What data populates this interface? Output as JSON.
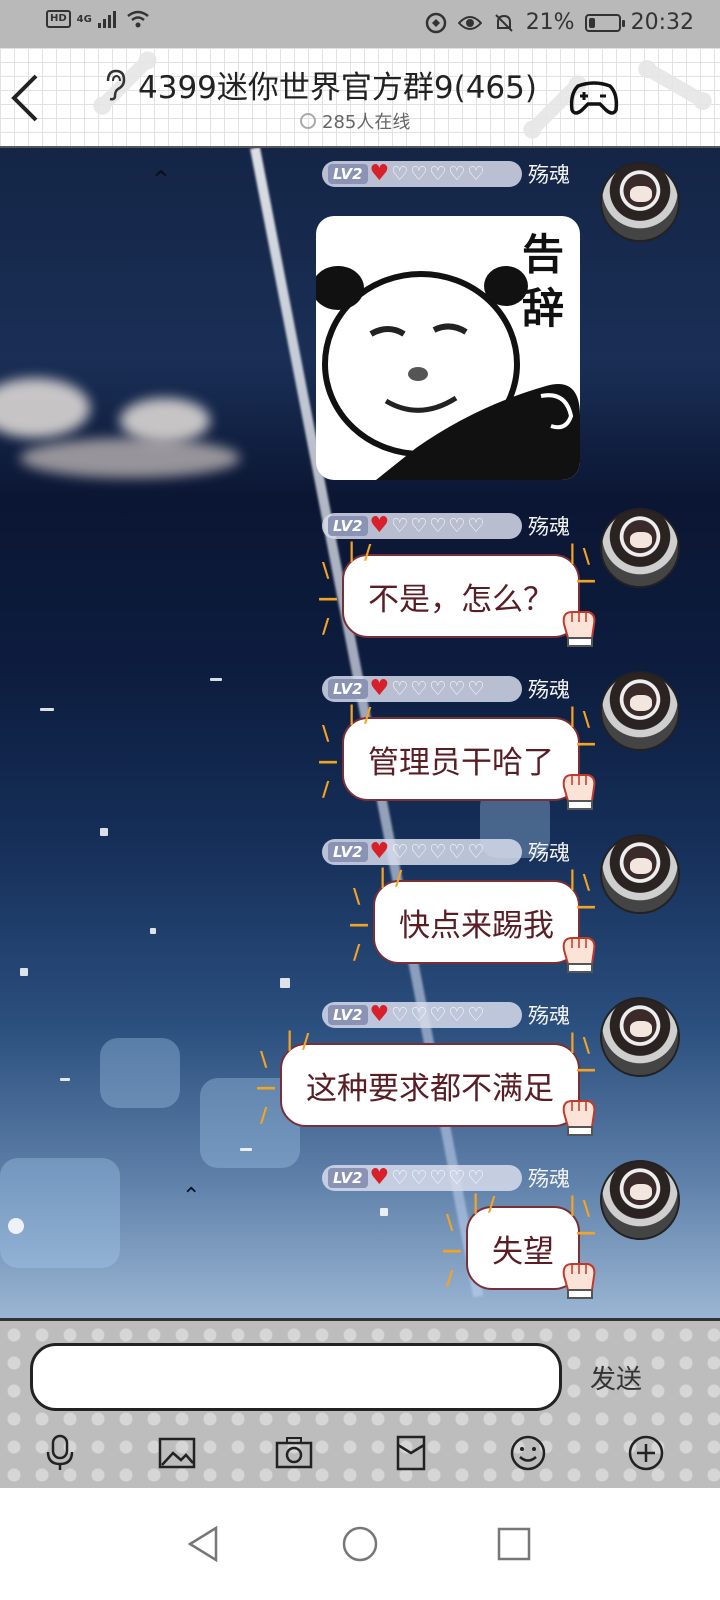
{
  "status_bar": {
    "hd": "HD",
    "network": "4G",
    "battery_percent": "21%",
    "battery_level": 0.21,
    "time": "20:32"
  },
  "header": {
    "title": "4399迷你世界官方群9(465)",
    "online_text": "285人在线"
  },
  "messages": [
    {
      "type": "sticker",
      "level": "LV2",
      "nickname": "殇魂",
      "sticker_text": "告辞"
    },
    {
      "type": "text",
      "level": "LV2",
      "nickname": "殇魂",
      "text": "不是，怎么？"
    },
    {
      "type": "text",
      "level": "LV2",
      "nickname": "殇魂",
      "text": "管理员干哈了"
    },
    {
      "type": "text",
      "level": "LV2",
      "nickname": "殇魂",
      "text": "快点来踢我"
    },
    {
      "type": "text",
      "level": "LV2",
      "nickname": "殇魂",
      "text": "这种要求都不满足"
    },
    {
      "type": "text",
      "level": "LV2",
      "nickname": "殇魂",
      "text": "失望"
    }
  ],
  "input": {
    "value": "",
    "placeholder": "",
    "send_label": "发送"
  },
  "toolbar_icons": [
    "microphone-icon",
    "image-icon",
    "camera-icon",
    "red-packet-icon",
    "emoji-icon",
    "plus-icon"
  ],
  "colors": {
    "bubble_text": "#5a1d24",
    "bubble_border": "#7a2f36",
    "heart": "#d8202a",
    "burst": "#f4a422"
  }
}
